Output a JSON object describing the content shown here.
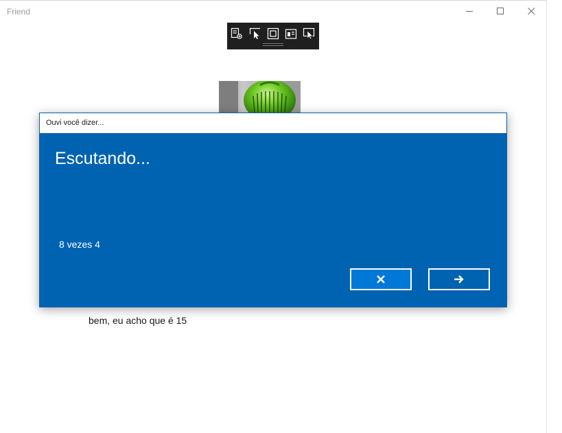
{
  "window": {
    "title": "Friend",
    "controls": {
      "minimize": "minimize-icon",
      "maximize": "maximize-icon",
      "close": "close-icon"
    }
  },
  "debug_toolbar": {
    "icons": [
      "live-visual-tree-icon",
      "select-element-icon",
      "display-layout-adorners-icon",
      "track-focus-icon",
      "preview-selection-icon"
    ]
  },
  "avatar": {
    "icon": "green-ball-avatar"
  },
  "conversation": {
    "response": "bem, eu acho que é 15"
  },
  "speech_dialog": {
    "title": "Ouvi você dizer...",
    "heading": "Escutando...",
    "heard_text": "8 vezes 4",
    "cancel_icon": "close-icon",
    "confirm_icon": "arrow-right-icon"
  },
  "colors": {
    "dialog_background": "#0063b1",
    "toolbar_background": "#1f1f1f",
    "accent": "#0078d7"
  }
}
